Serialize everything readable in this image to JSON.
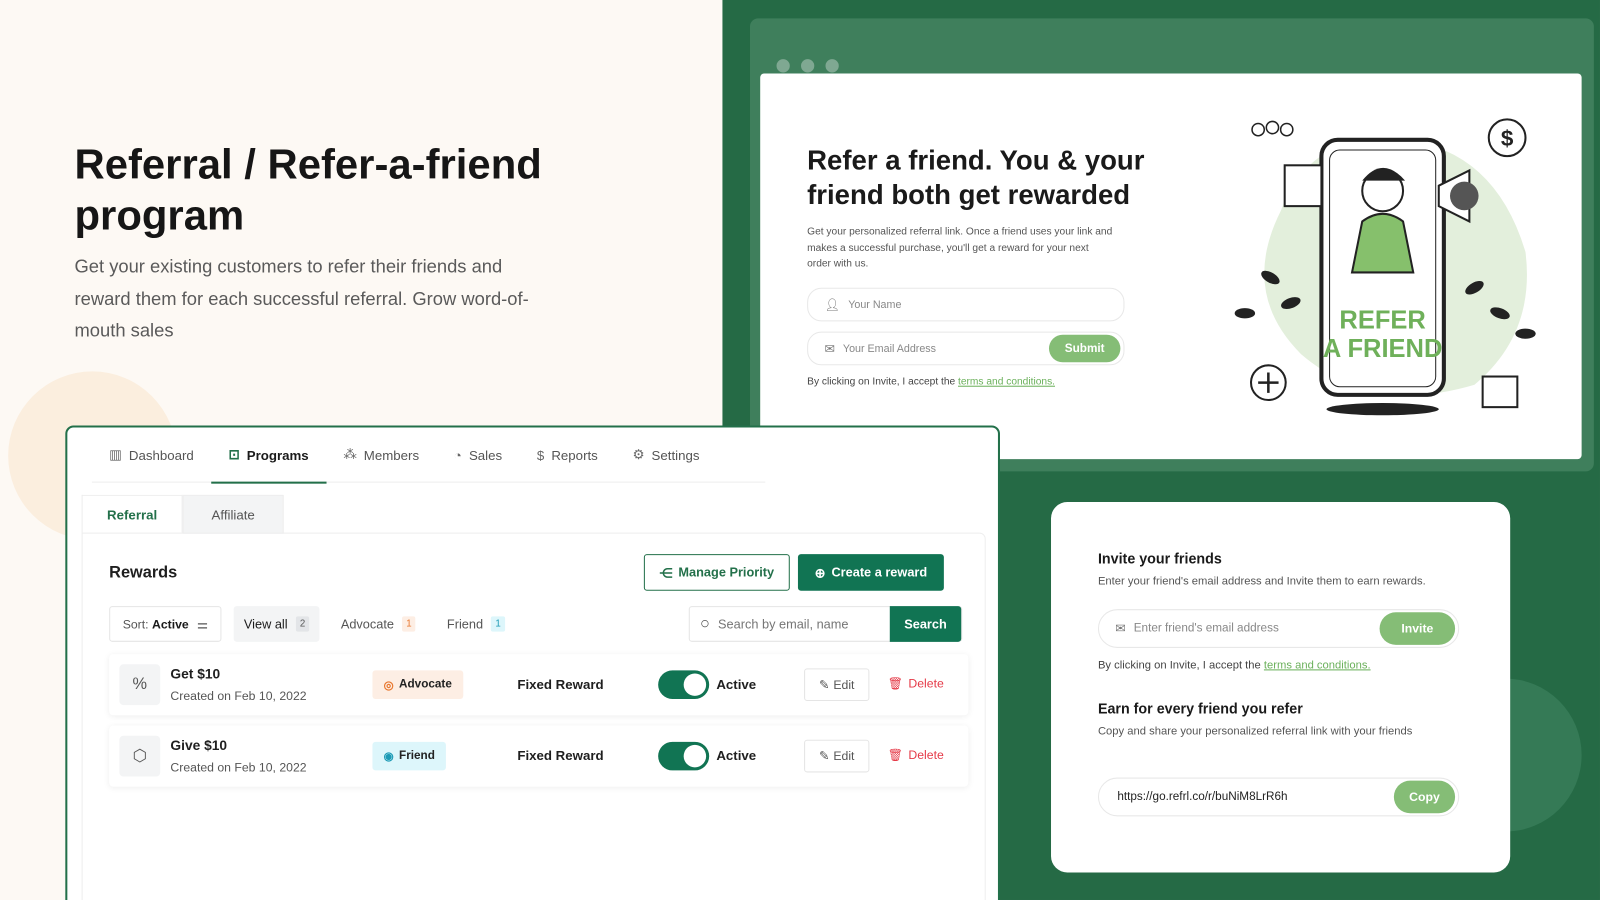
{
  "hero": {
    "title": "Referral / Refer-a-friend program",
    "subtitle": "Get your existing customers to refer their friends and reward them for each successful referral. Grow word-of-mouth sales"
  },
  "widget": {
    "title": "Refer a friend. You & your friend both get rewarded",
    "description": "Get your personalized referral link. Once a friend uses your link and makes a successful purchase, you'll get a reward for your next order with us.",
    "name_placeholder": "Your Name",
    "email_placeholder": "Your Email Address",
    "submit_label": "Submit",
    "terms_prefix": "By clicking on Invite, I accept the ",
    "terms_link": "terms and conditions.",
    "illustration_text": "REFER A FRIEND"
  },
  "dashboard": {
    "nav": [
      {
        "label": "Dashboard",
        "icon": "bar-chart-icon"
      },
      {
        "label": "Programs",
        "icon": "presentation-icon",
        "active": true
      },
      {
        "label": "Members",
        "icon": "members-icon"
      },
      {
        "label": "Sales",
        "icon": "pie-chart-icon"
      },
      {
        "label": "Reports",
        "icon": "dollar-refresh-icon"
      },
      {
        "label": "Settings",
        "icon": "gear-icon"
      }
    ],
    "subtabs": [
      "Referral",
      "Affiliate"
    ],
    "rewards_title": "Rewards",
    "manage_priority": "Manage Priority",
    "create_reward": "Create a reward",
    "sort_label": "Sort:",
    "sort_value": "Active",
    "filters": [
      {
        "label": "View all",
        "count": "2"
      },
      {
        "label": "Advocate",
        "count": "1"
      },
      {
        "label": "Friend",
        "count": "1"
      }
    ],
    "search_placeholder": "Search by email, name",
    "search_button": "Search",
    "rows": [
      {
        "name": "Get $10",
        "created": "Created on Feb 10, 2022",
        "badge": "Advocate",
        "type": "Fixed Reward",
        "status": "Active",
        "enabled": true,
        "edit": "Edit",
        "delete": "Delete"
      },
      {
        "name": "Give $10",
        "created": "Created on Feb 10, 2022",
        "badge": "Friend",
        "type": "Fixed Reward",
        "status": "Active",
        "enabled": true,
        "edit": "Edit",
        "delete": "Delete"
      }
    ]
  },
  "invite": {
    "title": "Invite your friends",
    "subtitle": "Enter your friend's email address and Invite them to earn rewards.",
    "email_placeholder": "Enter friend's email address",
    "invite_button": "Invite",
    "terms_prefix": "By clicking on Invite, I accept the ",
    "terms_link": "terms and conditions.",
    "earn_title": "Earn for every friend you refer",
    "earn_subtitle": "Copy and share your personalized referral link with your friends",
    "link": "https://go.refrl.co/r/buNiM8LrR6h",
    "copy_button": "Copy"
  },
  "colors": {
    "primary": "#117453",
    "accent_light": "#85bd76",
    "panel_green": "#256a45",
    "danger": "#e53947"
  }
}
